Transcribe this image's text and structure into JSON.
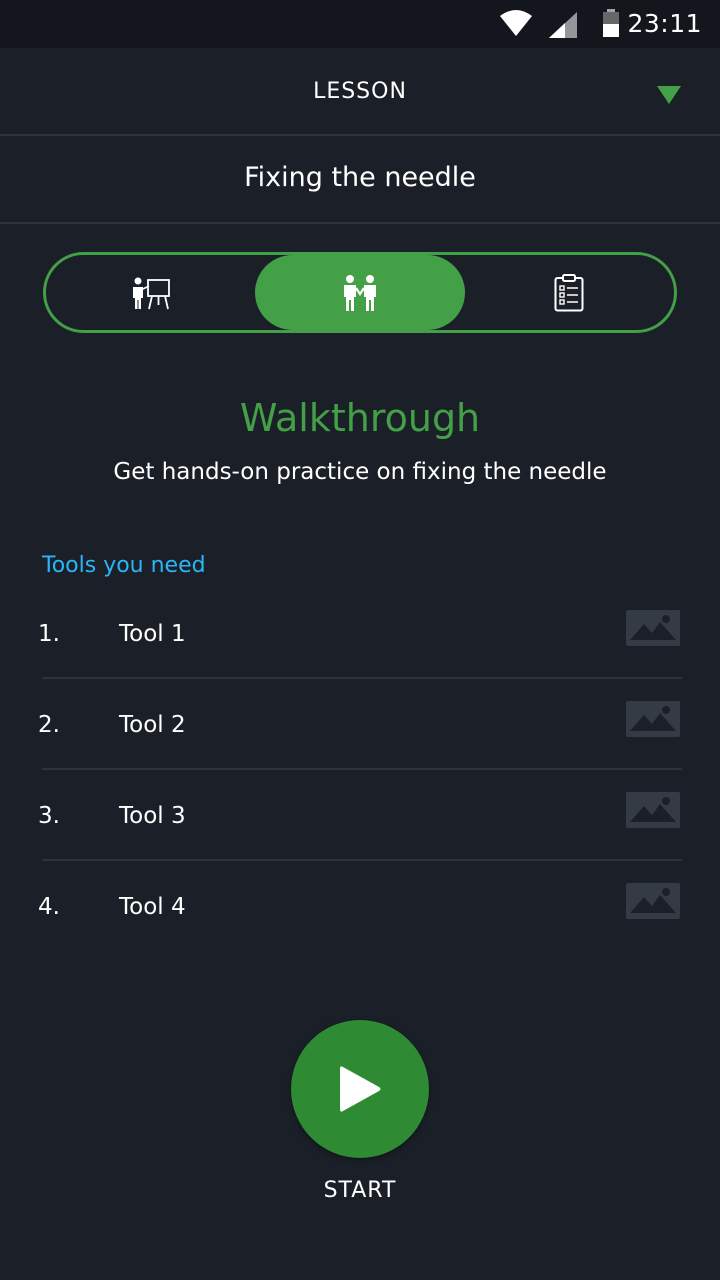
{
  "status_bar": {
    "time": "23:11",
    "icons": [
      "wifi-icon",
      "signal-icon",
      "battery-icon"
    ]
  },
  "header": {
    "title": "LESSON",
    "dropdown_icon": "triangle-down-icon"
  },
  "lesson": {
    "name": "Fixing the needle"
  },
  "mode_toggle": {
    "items": [
      {
        "icon": "presentation-icon",
        "selected": false
      },
      {
        "icon": "walkthrough-icon",
        "selected": true
      },
      {
        "icon": "checklist-icon",
        "selected": false
      }
    ]
  },
  "section": {
    "title": "Walkthrough",
    "subtitle": "Get hands-on practice on fixing the needle"
  },
  "tools": {
    "heading": "Tools you need",
    "items": [
      {
        "number": "1.",
        "name": "Tool 1",
        "icon": "image-placeholder-icon"
      },
      {
        "number": "2.",
        "name": "Tool 2",
        "icon": "image-placeholder-icon"
      },
      {
        "number": "3.",
        "name": "Tool 3",
        "icon": "image-placeholder-icon"
      },
      {
        "number": "4.",
        "name": "Tool 4",
        "icon": "image-placeholder-icon"
      }
    ]
  },
  "start": {
    "label": "START",
    "icon": "play-icon"
  },
  "colors": {
    "background": "#1b2028",
    "accent_green": "#43a047",
    "link_blue": "#29b6f6",
    "divider": "#2d333c"
  }
}
